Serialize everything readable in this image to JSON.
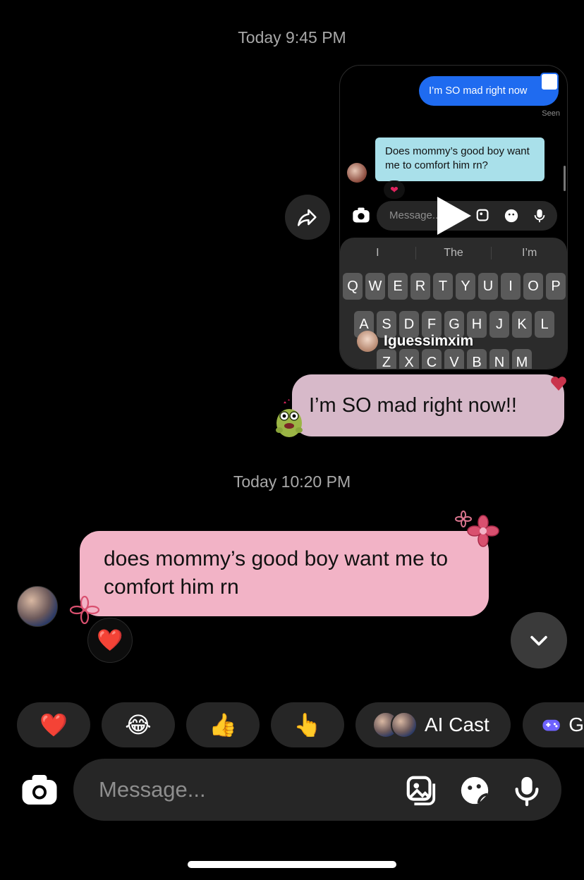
{
  "timestamps": {
    "first": "Today 9:45 PM",
    "second": "Today 10:20 PM"
  },
  "shared_reel": {
    "inner_sent_message": "I’m SO mad right now",
    "inner_seen": "Seen",
    "inner_received_message": "Does mommy’s good boy want me to comfort him rn?",
    "inner_reaction": "❤",
    "inner_input_placeholder": "Message...",
    "keyboard_suggestions": [
      "I",
      "The",
      "I’m"
    ],
    "keyboard_row1": [
      "Q",
      "W",
      "E",
      "R",
      "T",
      "Y",
      "U",
      "I",
      "O",
      "P"
    ],
    "keyboard_row2": [
      "A",
      "S",
      "D",
      "F",
      "G",
      "H",
      "J",
      "K",
      "L"
    ],
    "keyboard_row3": [
      "Z",
      "X",
      "C",
      "V",
      "B",
      "N",
      "M"
    ],
    "creator_name": "Iguessimxim"
  },
  "outgoing_message": {
    "text": "I’m SO mad right now!!"
  },
  "incoming_message": {
    "text": "does mommy’s good boy want me to comfort him rn",
    "reaction": "❤️"
  },
  "quick_reactions": [
    "❤️",
    "😂",
    "👍",
    "👆"
  ],
  "ai_cast_label": "AI Cast",
  "games_label": "G",
  "composer": {
    "placeholder": "Message..."
  },
  "colors": {
    "background": "#000000",
    "outgoing_bubble": "#d7b9c9",
    "incoming_bubble": "#f2b3c6",
    "chip": "#262626"
  }
}
